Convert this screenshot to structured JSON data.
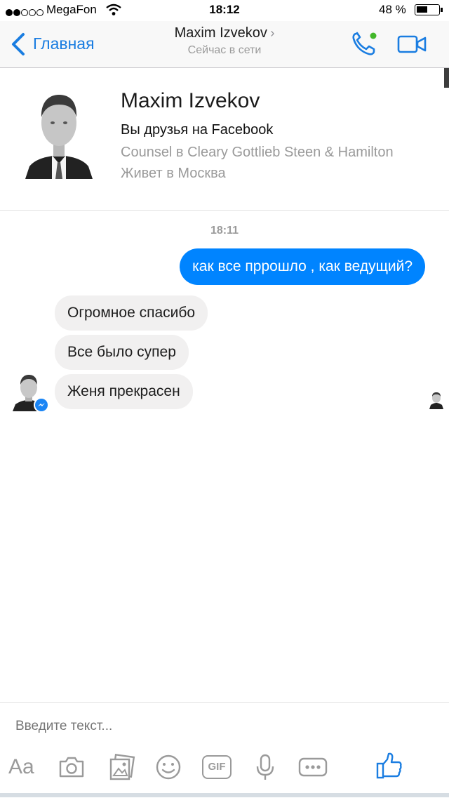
{
  "status_bar": {
    "carrier": "MegaFon",
    "time": "18:12",
    "battery": "48 %"
  },
  "nav": {
    "back_label": "Главная",
    "contact_name": "Maxim Izvekov",
    "contact_status": "Сейчас в сети",
    "accent_color": "#1a7de1"
  },
  "profile": {
    "name": "Maxim Izvekov",
    "friends_line": "Вы друзья на Facebook",
    "work_line": "Counsel в Cleary Gottlieb Steen & Hamilton",
    "lives_line": "Живет в Москва"
  },
  "conversation": {
    "timestamp": "18:11",
    "outgoing": [
      {
        "text": "как все пррошло , как ведущий?"
      }
    ],
    "incoming": [
      {
        "text": "Огромное спасибо"
      },
      {
        "text": "Все было супер"
      },
      {
        "text": "Женя прекрасен"
      }
    ]
  },
  "composer": {
    "placeholder": "Введите текст...",
    "text_tool_label": "Aa",
    "gif_label": "GIF",
    "icons": [
      "text-icon",
      "camera-icon",
      "gallery-icon",
      "emoji-icon",
      "gif-icon",
      "microphone-icon",
      "more-icon",
      "like-icon"
    ]
  }
}
